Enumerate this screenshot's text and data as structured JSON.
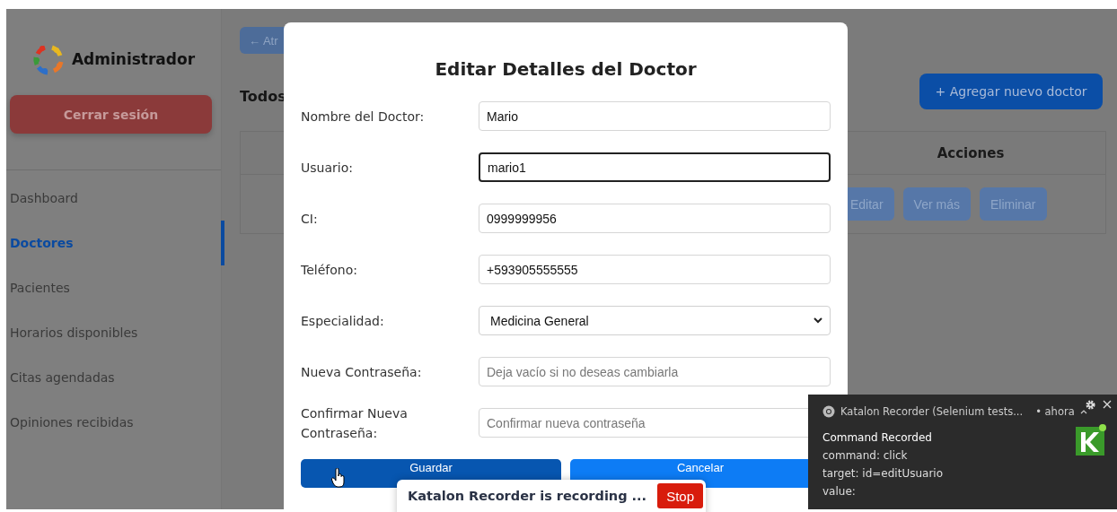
{
  "sidebar": {
    "title": "Administrador",
    "logout_button": "Cerrar sesión",
    "items": [
      {
        "label": "Dashboard",
        "selected": false
      },
      {
        "label": "Doctores",
        "selected": true
      },
      {
        "label": "Pacientes",
        "selected": false
      },
      {
        "label": "Horarios disponibles",
        "selected": false
      },
      {
        "label": "Citas agendadas",
        "selected": false
      },
      {
        "label": "Opiniones recibidas",
        "selected": false
      }
    ]
  },
  "main": {
    "back_button": "← Atr",
    "heading": "Todos",
    "add_button": "+ Agregar nuevo doctor",
    "table": {
      "columns": [
        "Acciones"
      ],
      "rows": [
        {
          "actions": [
            "Editar",
            "Ver más",
            "Eliminar"
          ]
        }
      ]
    }
  },
  "modal": {
    "title": "Editar Detalles del Doctor",
    "fields": [
      {
        "label": "Nombre del Doctor:",
        "kind": "text",
        "value": "Mario",
        "focused": false
      },
      {
        "label": "Usuario:",
        "kind": "text",
        "value": "mario1",
        "focused": true
      },
      {
        "label": "CI:",
        "kind": "text",
        "value": "0999999956",
        "focused": false
      },
      {
        "label": "Teléfono:",
        "kind": "text",
        "value": "+593905555555",
        "focused": false
      },
      {
        "label": "Especialidad:",
        "kind": "select",
        "value": "Medicina General",
        "focused": false
      },
      {
        "label": "Nueva Contraseña:",
        "kind": "password",
        "placeholder": "Deja vacío si no deseas cambiarla",
        "focused": false
      },
      {
        "label": "Confirmar Nueva Contraseña:",
        "kind": "password",
        "placeholder": "Confirmar nueva contraseña",
        "focused": false
      }
    ],
    "buttons": [
      {
        "label": "Guardar",
        "kind": "primary"
      },
      {
        "label": "Cancelar",
        "kind": "secondary"
      }
    ]
  },
  "notification": {
    "source": "Katalon Recorder (Selenium tests...",
    "time": "• ahora",
    "title": "Command Recorded",
    "lines": [
      "command: click",
      "target: id=editUsuario",
      "value:"
    ]
  },
  "recording_bar": {
    "text": "Katalon Recorder is recording ...",
    "button": "Stop"
  }
}
